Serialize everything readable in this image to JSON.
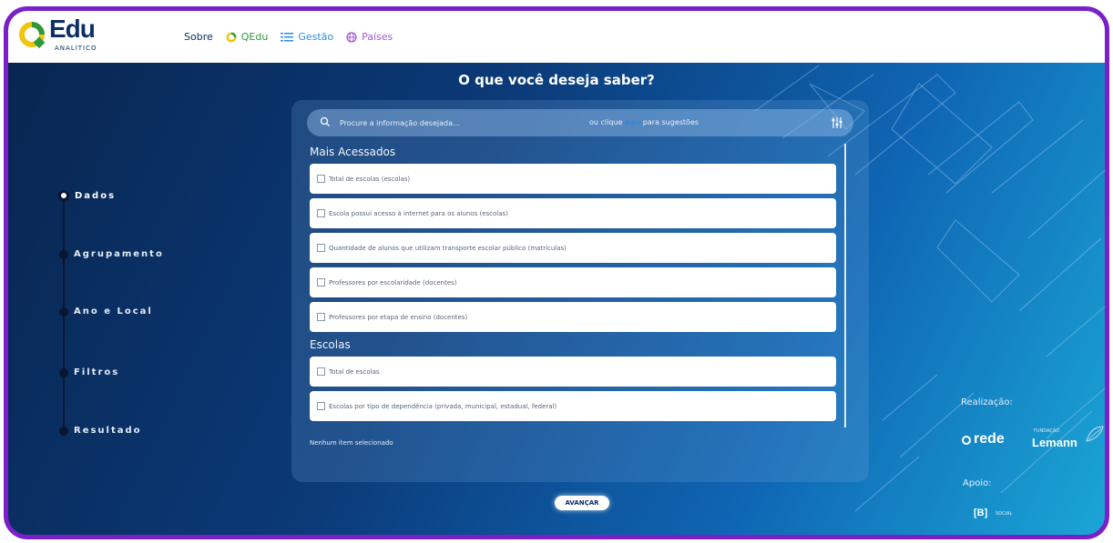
{
  "header": {
    "logo_text": "Edu",
    "logo_subtext": "ANALÍTICO",
    "nav": [
      {
        "label": "Sobre",
        "color": "#0b2f66",
        "icon": "none"
      },
      {
        "label": "QEdu",
        "color": "#2f9a3a",
        "icon": "qedu-icon"
      },
      {
        "label": "Gestão",
        "color": "#2c8de0",
        "icon": "list-icon"
      },
      {
        "label": "Países",
        "color": "#a25ad8",
        "icon": "globe-icon"
      }
    ]
  },
  "page_title": "O que você deseja saber?",
  "stepper": [
    {
      "label": "Dados",
      "active": true
    },
    {
      "label": "Agrupamento",
      "active": false
    },
    {
      "label": "Ano e Local",
      "active": false
    },
    {
      "label": "Filtros",
      "active": false
    },
    {
      "label": "Resultado",
      "active": false
    }
  ],
  "search": {
    "placeholder": "Procure a informação desejada...",
    "hint_before": "ou clique",
    "hint_link": "aqui",
    "hint_after": "para sugestões"
  },
  "sections": [
    {
      "title": "Mais Acessados",
      "items": [
        "Total de escolas (escolas)",
        "Escola possui acesso à internet para os alunos (escolas)",
        "Quantidade de alunos que utilizam transporte escolar público (matrículas)",
        "Professores por escolaridade (docentes)",
        "Professores por etapa de ensino (docentes)"
      ]
    },
    {
      "title": "Escolas",
      "items": [
        "Total de escolas",
        "Escolas por tipo de dependência (privada, municipal, estadual, federal)"
      ]
    }
  ],
  "selected_status": "Nenhum item selecionado",
  "advance_label": "AVANÇAR",
  "credits": {
    "realizacao": "Realização:",
    "rede": "rede",
    "lemann_small": "FUNDAÇÃO",
    "lemann": "Lemann",
    "apoio": "Apoio:",
    "b": "[B]",
    "social": "SOCIAL"
  },
  "colors": {
    "frame_border": "#7b1fc9",
    "background_dark": "#08254f",
    "background_light": "#1aa6d6",
    "link": "#2c7de8"
  }
}
